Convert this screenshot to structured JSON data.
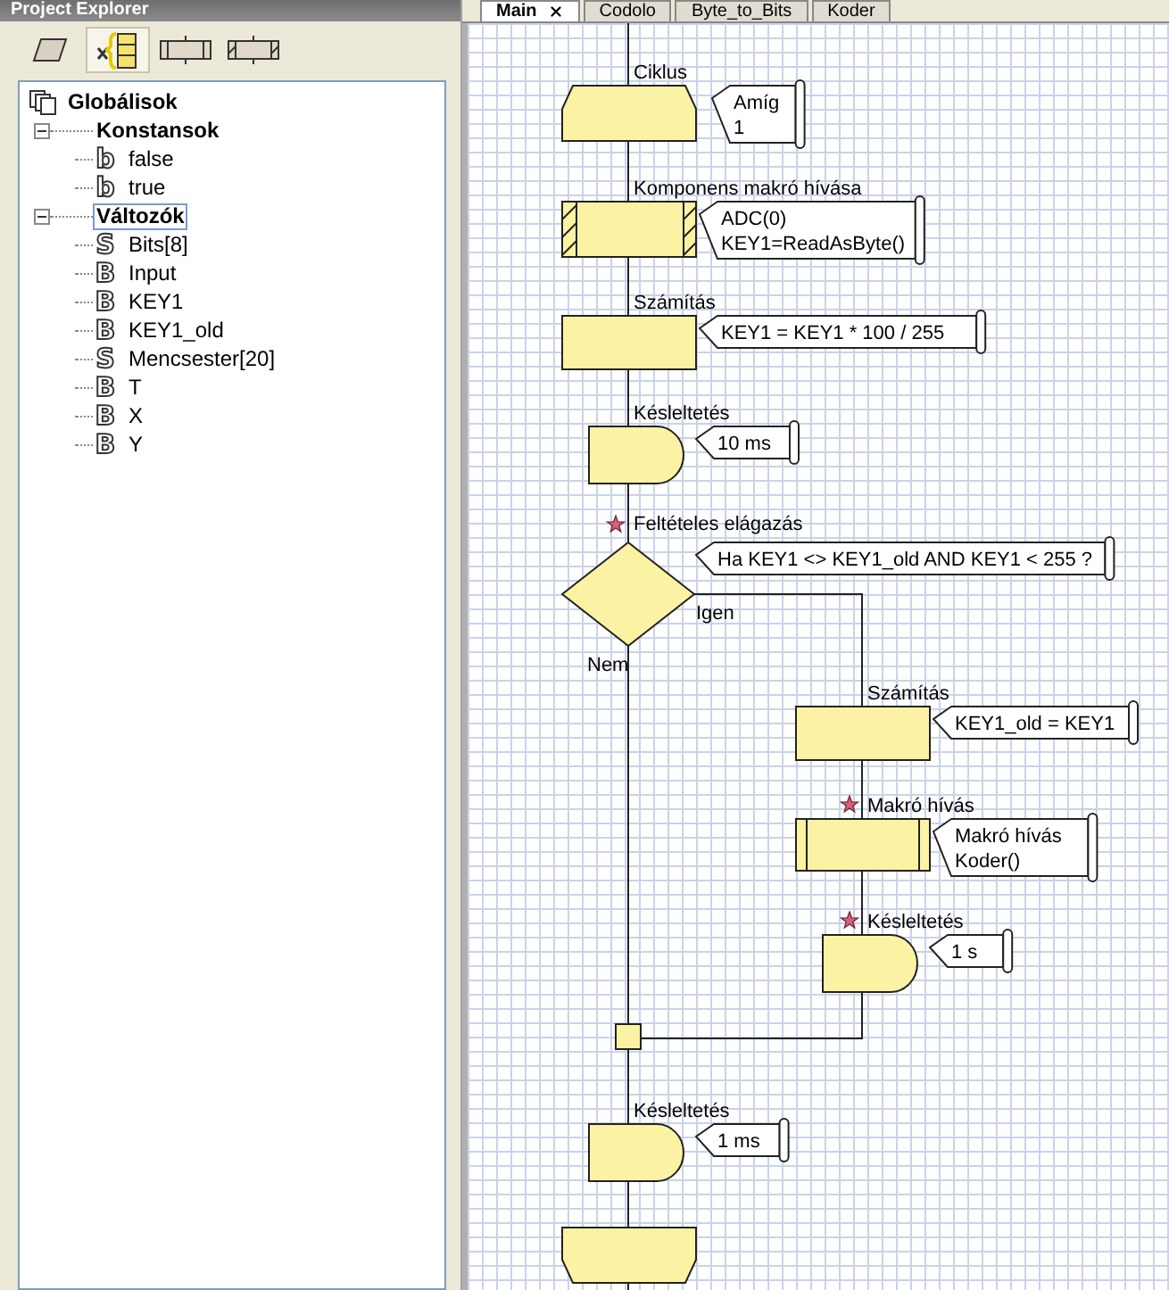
{
  "left_panel": {
    "title": "Project Explorer",
    "tabs": [
      {
        "kind": "io",
        "selected": false
      },
      {
        "kind": "variables",
        "selected": true
      },
      {
        "kind": "macros",
        "selected": false
      },
      {
        "kind": "components",
        "selected": false
      }
    ],
    "tree": [
      {
        "label": "Globálisok",
        "kind": "root",
        "selected": false,
        "children": [
          {
            "label": "Konstansok",
            "kind": "group",
            "expanded": true,
            "selected": false,
            "children": [
              {
                "label": "false",
                "kind": "leaf",
                "glyph": "b",
                "selected": false
              },
              {
                "label": "true",
                "kind": "leaf",
                "glyph": "b",
                "selected": false
              }
            ]
          },
          {
            "label": "Változók",
            "kind": "group",
            "expanded": true,
            "selected": true,
            "children": [
              {
                "label": "Bits[8]",
                "kind": "leaf",
                "glyph": "S",
                "selected": false
              },
              {
                "label": "Input",
                "kind": "leaf",
                "glyph": "B",
                "selected": false
              },
              {
                "label": "KEY1",
                "kind": "leaf",
                "glyph": "B",
                "selected": false
              },
              {
                "label": "KEY1_old",
                "kind": "leaf",
                "glyph": "B",
                "selected": false
              },
              {
                "label": "Mencsester[20]",
                "kind": "leaf",
                "glyph": "S",
                "selected": false
              },
              {
                "label": "T",
                "kind": "leaf",
                "glyph": "B",
                "selected": false
              },
              {
                "label": "X",
                "kind": "leaf",
                "glyph": "B",
                "selected": false
              },
              {
                "label": "Y",
                "kind": "leaf",
                "glyph": "B",
                "selected": false
              }
            ]
          }
        ]
      }
    ]
  },
  "editor": {
    "tabs": [
      {
        "label": "Main",
        "selected": true
      },
      {
        "label": "Codolo",
        "selected": false
      },
      {
        "label": "Byte_to_Bits",
        "selected": false
      },
      {
        "label": "Koder",
        "selected": false
      }
    ],
    "flowchart": {
      "steps": [
        {
          "kind": "loop",
          "title": "Ciklus",
          "starred": false,
          "comment": [
            "Amíg",
            "1"
          ]
        },
        {
          "kind": "component_macro",
          "title": "Komponens makró hívása",
          "starred": false,
          "comment": [
            "ADC(0)",
            "KEY1=ReadAsByte()"
          ]
        },
        {
          "kind": "calculation",
          "title": "Számítás",
          "starred": false,
          "comment": [
            "KEY1 = KEY1 * 100 / 255"
          ]
        },
        {
          "kind": "delay",
          "title": "Késleltetés",
          "starred": false,
          "comment": [
            "10 ms"
          ]
        },
        {
          "kind": "decision",
          "title": "Feltételes elágazás",
          "starred": true,
          "comment": [
            "Ha KEY1 <> KEY1_old AND KEY1 < 255 ?"
          ],
          "yes_label": "Igen",
          "no_label": "Nem",
          "yes_branch": [
            {
              "kind": "calculation",
              "title": "Számítás",
              "starred": false,
              "comment": [
                "KEY1_old = KEY1"
              ]
            },
            {
              "kind": "macro",
              "title": "Makró hívás",
              "starred": true,
              "comment": [
                "Makró hívás",
                "Koder()"
              ]
            },
            {
              "kind": "delay",
              "title": "Késleltetés",
              "starred": true,
              "comment": [
                "1 s"
              ]
            }
          ]
        },
        {
          "kind": "delay",
          "title": "Késleltetés",
          "starred": false,
          "comment": [
            "1 ms"
          ]
        },
        {
          "kind": "loop_end"
        }
      ]
    }
  }
}
